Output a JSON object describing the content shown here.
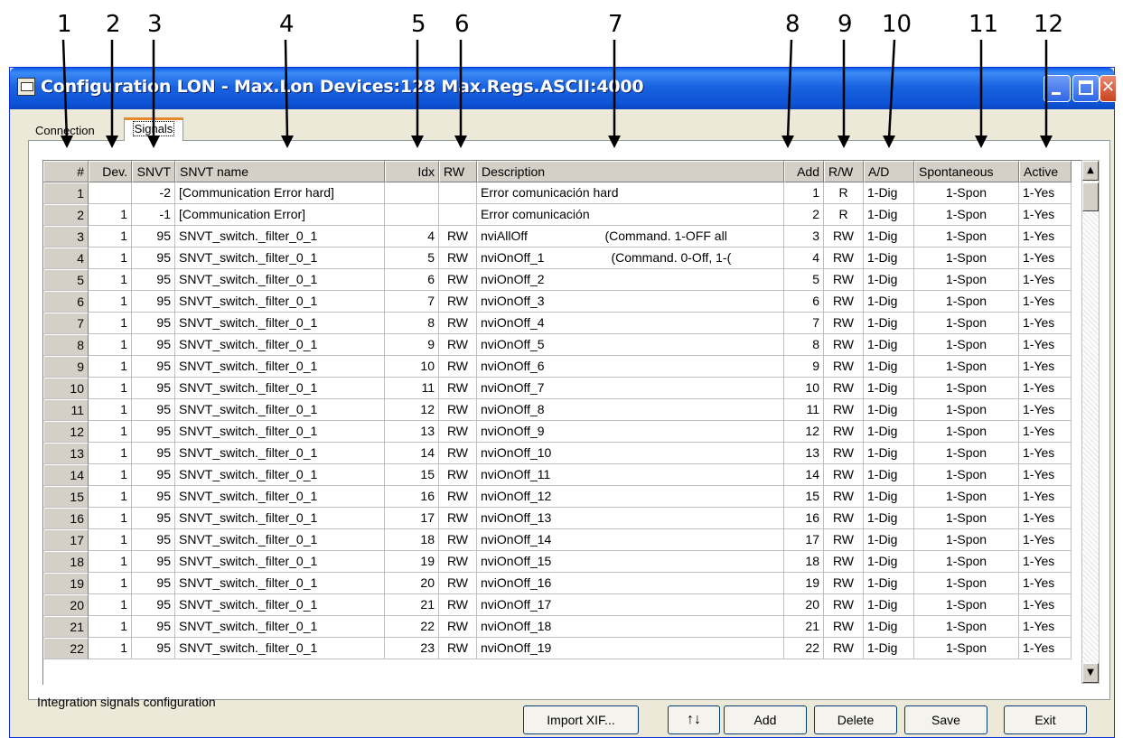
{
  "callouts": [
    "1",
    "2",
    "3",
    "4",
    "5",
    "6",
    "7",
    "8",
    "9",
    "10",
    "11",
    "12"
  ],
  "window": {
    "title": "Configuration LON - Max.Lon Devices:128 Max.Regs.ASCII:4000"
  },
  "tabs": {
    "connection": "Connection",
    "signals": "Signals"
  },
  "grid": {
    "headers": [
      "#",
      "Dev.",
      "SNVT",
      "SNVT name",
      "Idx",
      "RW",
      "Description",
      "Add",
      "R/W",
      "A/D",
      "Spontaneous",
      "Active"
    ],
    "rows": [
      [
        "1",
        "",
        "-2",
        "[Communication Error hard]",
        "",
        "",
        "Error comunicación hard",
        "1",
        "R",
        "1-Dig",
        "1-Spon",
        "1-Yes"
      ],
      [
        "2",
        "1",
        "-1",
        "[Communication Error]",
        "",
        "",
        "Error comunicación",
        "2",
        "R",
        "1-Dig",
        "1-Spon",
        "1-Yes"
      ],
      [
        "3",
        "1",
        "95",
        "SNVT_switch._filter_0_1",
        "4",
        "RW",
        "nviAllOff                      (Command. 1-OFF all",
        "3",
        "RW",
        "1-Dig",
        "1-Spon",
        "1-Yes"
      ],
      [
        "4",
        "1",
        "95",
        "SNVT_switch._filter_0_1",
        "5",
        "RW",
        "nviOnOff_1                   (Command. 0-Off, 1-(",
        "4",
        "RW",
        "1-Dig",
        "1-Spon",
        "1-Yes"
      ],
      [
        "5",
        "1",
        "95",
        "SNVT_switch._filter_0_1",
        "6",
        "RW",
        "nviOnOff_2",
        "5",
        "RW",
        "1-Dig",
        "1-Spon",
        "1-Yes"
      ],
      [
        "6",
        "1",
        "95",
        "SNVT_switch._filter_0_1",
        "7",
        "RW",
        "nviOnOff_3",
        "6",
        "RW",
        "1-Dig",
        "1-Spon",
        "1-Yes"
      ],
      [
        "7",
        "1",
        "95",
        "SNVT_switch._filter_0_1",
        "8",
        "RW",
        "nviOnOff_4",
        "7",
        "RW",
        "1-Dig",
        "1-Spon",
        "1-Yes"
      ],
      [
        "8",
        "1",
        "95",
        "SNVT_switch._filter_0_1",
        "9",
        "RW",
        "nviOnOff_5",
        "8",
        "RW",
        "1-Dig",
        "1-Spon",
        "1-Yes"
      ],
      [
        "9",
        "1",
        "95",
        "SNVT_switch._filter_0_1",
        "10",
        "RW",
        "nviOnOff_6",
        "9",
        "RW",
        "1-Dig",
        "1-Spon",
        "1-Yes"
      ],
      [
        "10",
        "1",
        "95",
        "SNVT_switch._filter_0_1",
        "11",
        "RW",
        "nviOnOff_7",
        "10",
        "RW",
        "1-Dig",
        "1-Spon",
        "1-Yes"
      ],
      [
        "11",
        "1",
        "95",
        "SNVT_switch._filter_0_1",
        "12",
        "RW",
        "nviOnOff_8",
        "11",
        "RW",
        "1-Dig",
        "1-Spon",
        "1-Yes"
      ],
      [
        "12",
        "1",
        "95",
        "SNVT_switch._filter_0_1",
        "13",
        "RW",
        "nviOnOff_9",
        "12",
        "RW",
        "1-Dig",
        "1-Spon",
        "1-Yes"
      ],
      [
        "13",
        "1",
        "95",
        "SNVT_switch._filter_0_1",
        "14",
        "RW",
        "nviOnOff_10",
        "13",
        "RW",
        "1-Dig",
        "1-Spon",
        "1-Yes"
      ],
      [
        "14",
        "1",
        "95",
        "SNVT_switch._filter_0_1",
        "15",
        "RW",
        "nviOnOff_11",
        "14",
        "RW",
        "1-Dig",
        "1-Spon",
        "1-Yes"
      ],
      [
        "15",
        "1",
        "95",
        "SNVT_switch._filter_0_1",
        "16",
        "RW",
        "nviOnOff_12",
        "15",
        "RW",
        "1-Dig",
        "1-Spon",
        "1-Yes"
      ],
      [
        "16",
        "1",
        "95",
        "SNVT_switch._filter_0_1",
        "17",
        "RW",
        "nviOnOff_13",
        "16",
        "RW",
        "1-Dig",
        "1-Spon",
        "1-Yes"
      ],
      [
        "17",
        "1",
        "95",
        "SNVT_switch._filter_0_1",
        "18",
        "RW",
        "nviOnOff_14",
        "17",
        "RW",
        "1-Dig",
        "1-Spon",
        "1-Yes"
      ],
      [
        "18",
        "1",
        "95",
        "SNVT_switch._filter_0_1",
        "19",
        "RW",
        "nviOnOff_15",
        "18",
        "RW",
        "1-Dig",
        "1-Spon",
        "1-Yes"
      ],
      [
        "19",
        "1",
        "95",
        "SNVT_switch._filter_0_1",
        "20",
        "RW",
        "nviOnOff_16",
        "19",
        "RW",
        "1-Dig",
        "1-Spon",
        "1-Yes"
      ],
      [
        "20",
        "1",
        "95",
        "SNVT_switch._filter_0_1",
        "21",
        "RW",
        "nviOnOff_17",
        "20",
        "RW",
        "1-Dig",
        "1-Spon",
        "1-Yes"
      ],
      [
        "21",
        "1",
        "95",
        "SNVT_switch._filter_0_1",
        "22",
        "RW",
        "nviOnOff_18",
        "21",
        "RW",
        "1-Dig",
        "1-Spon",
        "1-Yes"
      ],
      [
        "22",
        "1",
        "95",
        "SNVT_switch._filter_0_1",
        "23",
        "RW",
        "nviOnOff_19",
        "22",
        "RW",
        "1-Dig",
        "1-Spon",
        "1-Yes"
      ]
    ]
  },
  "status": {
    "text": "Integration signals configuration"
  },
  "buttons": {
    "import": "Import XIF...",
    "updown": "↑↓",
    "add": "Add",
    "delete": "Delete",
    "save": "Save",
    "exit": "Exit"
  },
  "icons": {
    "scroll_up": "scroll-up-arrow-icon",
    "scroll_down": "scroll-down-arrow-icon"
  },
  "colors": {
    "titlebar": "#0A5FE8",
    "window_bg": "#ECE9D8",
    "active_tab_accent": "#E68B2C"
  }
}
